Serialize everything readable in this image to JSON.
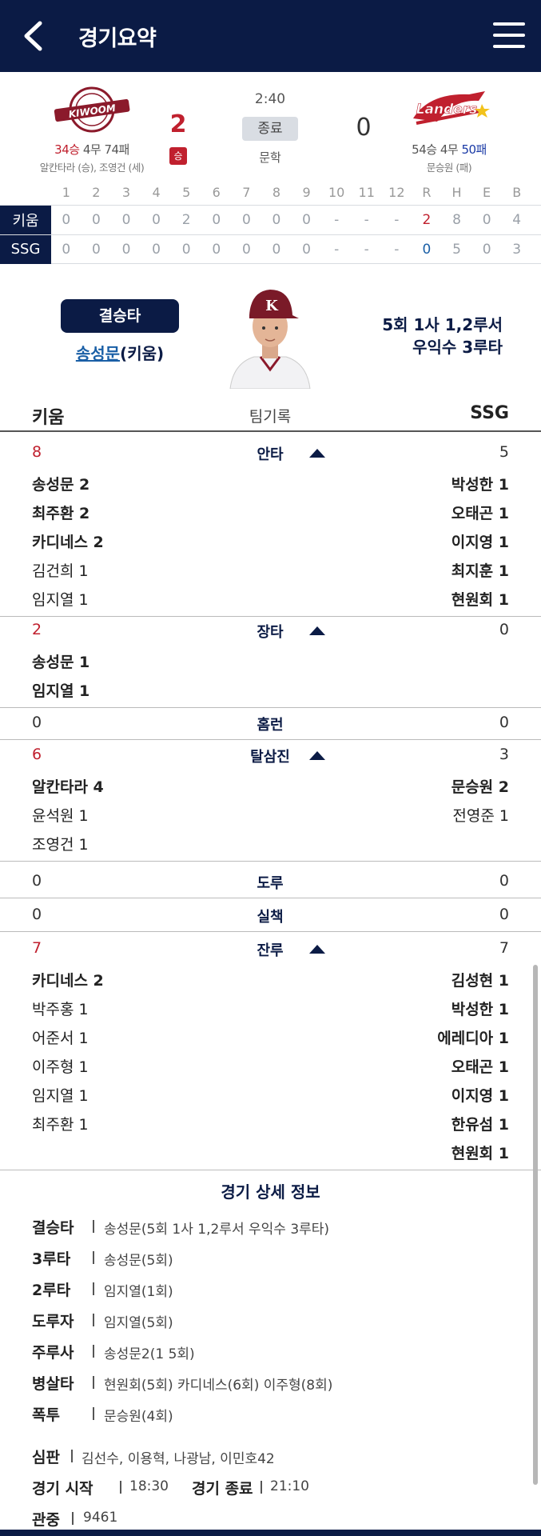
{
  "header": {
    "title": "경기요약",
    "back_icon": "chevron-left-icon",
    "menu_icon": "hamburger-menu-icon"
  },
  "game": {
    "time": "2:40",
    "status": "종료",
    "stadium": "문학",
    "away": {
      "logo_text": "KIWOOM",
      "record_w": "34승",
      "record_d": " 4무 ",
      "record_l": "74패",
      "pitchers": "알칸타라 (승), 조영건 (세)",
      "score": "2",
      "result_badge": "승",
      "color": "#8b1a2b"
    },
    "home": {
      "logo_text": "Landers",
      "record_w": "54승",
      "record_d": " 4무 ",
      "record_l": "50패",
      "pitchers": "문승원 (패)",
      "score": "0",
      "color": "#c0202e"
    }
  },
  "linescore": {
    "headers": [
      "1",
      "2",
      "3",
      "4",
      "5",
      "6",
      "7",
      "8",
      "9",
      "10",
      "11",
      "12",
      "R",
      "H",
      "E",
      "B"
    ],
    "rows": [
      {
        "team": "키움",
        "cells": [
          "0",
          "0",
          "0",
          "0",
          "2",
          "0",
          "0",
          "0",
          "0",
          "-",
          "-",
          "-",
          "2",
          "8",
          "0",
          "4"
        ]
      },
      {
        "team": "SSG",
        "cells": [
          "0",
          "0",
          "0",
          "0",
          "0",
          "0",
          "0",
          "0",
          "0",
          "-",
          "-",
          "-",
          "0",
          "5",
          "0",
          "3"
        ]
      }
    ]
  },
  "decisive_hit": {
    "badge": "결승타",
    "player_name": "송성문",
    "player_team": "(키움)",
    "desc_line1": "5회 1사 1,2루서",
    "desc_line2": "우익수 3루타"
  },
  "team_records": {
    "left_team": "키움",
    "center_label": "팀기록",
    "right_team": "SSG",
    "categories": [
      {
        "title": "안타",
        "left_value": "8",
        "right_value": "5",
        "left": [
          {
            "t": "송성문 2",
            "b": true
          },
          {
            "t": "최주환 2",
            "b": true
          },
          {
            "t": "카디네스 2",
            "b": true
          },
          {
            "t": "김건희 1",
            "b": false
          },
          {
            "t": "임지열 1",
            "b": false
          }
        ],
        "right": [
          {
            "t": "박성한 1",
            "b": true
          },
          {
            "t": "오태곤 1",
            "b": true
          },
          {
            "t": "이지영 1",
            "b": true
          },
          {
            "t": "최지훈 1",
            "b": true
          },
          {
            "t": "현원회 1",
            "b": true
          }
        ]
      },
      {
        "title": "장타",
        "left_value": "2",
        "right_value": "0",
        "left": [
          {
            "t": "송성문 1",
            "b": true
          },
          {
            "t": "임지열 1",
            "b": true
          }
        ],
        "right": []
      },
      {
        "title": "홈런",
        "left_value": "0",
        "right_value": "0",
        "left": [],
        "right": []
      },
      {
        "title": "탈삼진",
        "left_value": "6",
        "right_value": "3",
        "left": [
          {
            "t": "알칸타라 4",
            "b": true
          },
          {
            "t": "윤석원 1",
            "b": false
          },
          {
            "t": "조영건 1",
            "b": false
          }
        ],
        "right": [
          {
            "t": "문승원 2",
            "b": true
          },
          {
            "t": "전영준 1",
            "b": false
          }
        ]
      },
      {
        "title": "도루",
        "left_value": "0",
        "right_value": "0",
        "left": [],
        "right": []
      },
      {
        "title": "실책",
        "left_value": "0",
        "right_value": "0",
        "left": [],
        "right": []
      },
      {
        "title": "잔루",
        "left_value": "7",
        "right_value": "7",
        "left": [
          {
            "t": "카디네스 2",
            "b": true
          },
          {
            "t": "박주홍 1",
            "b": false
          },
          {
            "t": "어준서 1",
            "b": false
          },
          {
            "t": "이주형 1",
            "b": false
          },
          {
            "t": "임지열 1",
            "b": false
          },
          {
            "t": "최주환 1",
            "b": false
          }
        ],
        "right": [
          {
            "t": "김성현 1",
            "b": true
          },
          {
            "t": "박성한 1",
            "b": true
          },
          {
            "t": "에레디아 1",
            "b": true
          },
          {
            "t": "오태곤 1",
            "b": true
          },
          {
            "t": "이지영 1",
            "b": true
          },
          {
            "t": "한유섬 1",
            "b": true
          },
          {
            "t": "현원회 1",
            "b": true
          }
        ]
      }
    ]
  },
  "details": {
    "title": "경기 상세 정보",
    "rows": [
      {
        "label": "결승타",
        "value": "송성문(5회 1사 1,2루서 우익수 3루타)"
      },
      {
        "label": "3루타",
        "value": "송성문(5회)"
      },
      {
        "label": "2루타",
        "value": "임지열(1회)"
      },
      {
        "label": "도루자",
        "value": "임지열(5회)"
      },
      {
        "label": "주루사",
        "value": "송성문2(1 5회)"
      },
      {
        "label": "병살타",
        "value": "현원회(5회) 카디네스(6회) 이주형(8회)"
      },
      {
        "label": "폭투",
        "value": "문승원(4회)"
      }
    ],
    "umpire_label": "심판",
    "umpires": "김선수, 이용혁, 나광남, 이민호42",
    "start_label": "경기 시작",
    "start_time": "18:30",
    "end_label": "경기 종료",
    "end_time": "21:10",
    "attendance_label": "관중",
    "attendance": "9461"
  }
}
